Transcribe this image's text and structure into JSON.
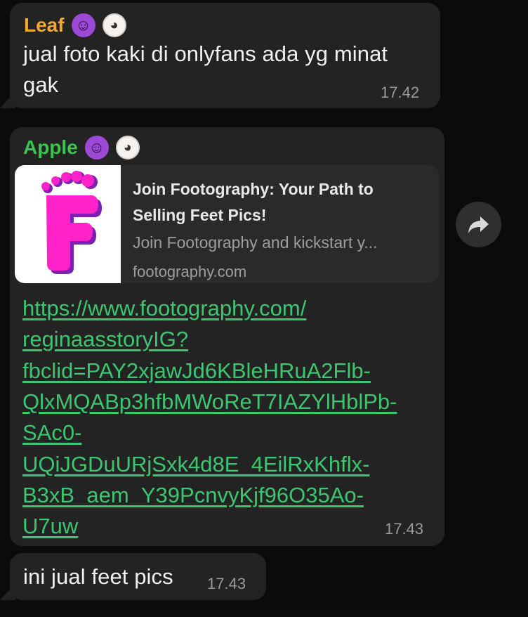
{
  "messages": [
    {
      "sender": "Leaf",
      "sender_color": "#f6a631",
      "emoji_1": "devil-face-icon",
      "emoji_2": "cow-face-icon",
      "text": "jual foto kaki di onlyfans ada yg minat\ngak",
      "time": "17.42"
    },
    {
      "sender": "Apple",
      "sender_color": "#39c64f",
      "emoji_1": "devil-face-icon",
      "emoji_2": "cow-face-icon",
      "preview": {
        "title": "Join Footography: Your Path to Selling Feet Pics!",
        "description": "Join Footography and kickstart y...",
        "domain": "footography.com",
        "logo_letter": "F",
        "logo_color": "#ff22c8"
      },
      "link": "https://www.footography.com/\nreginaasstoryIG?\nfbclid=PAY2xjawJd6KBleHRuA2Flb-\nQlxMQABp3hfbMWoReT7IAZYlHblPb-\nSAc0-\nUQiJGDuURjSxk4d8E_4EilRxKhflx-\nB3xB_aem_Y39PcnvyKjf96O35Ao-\nU7uw",
      "time": "17.43"
    },
    {
      "text": "ini jual feet pics",
      "time": "17.43"
    }
  ],
  "icons": {
    "forward": "forward-arrow-icon"
  }
}
